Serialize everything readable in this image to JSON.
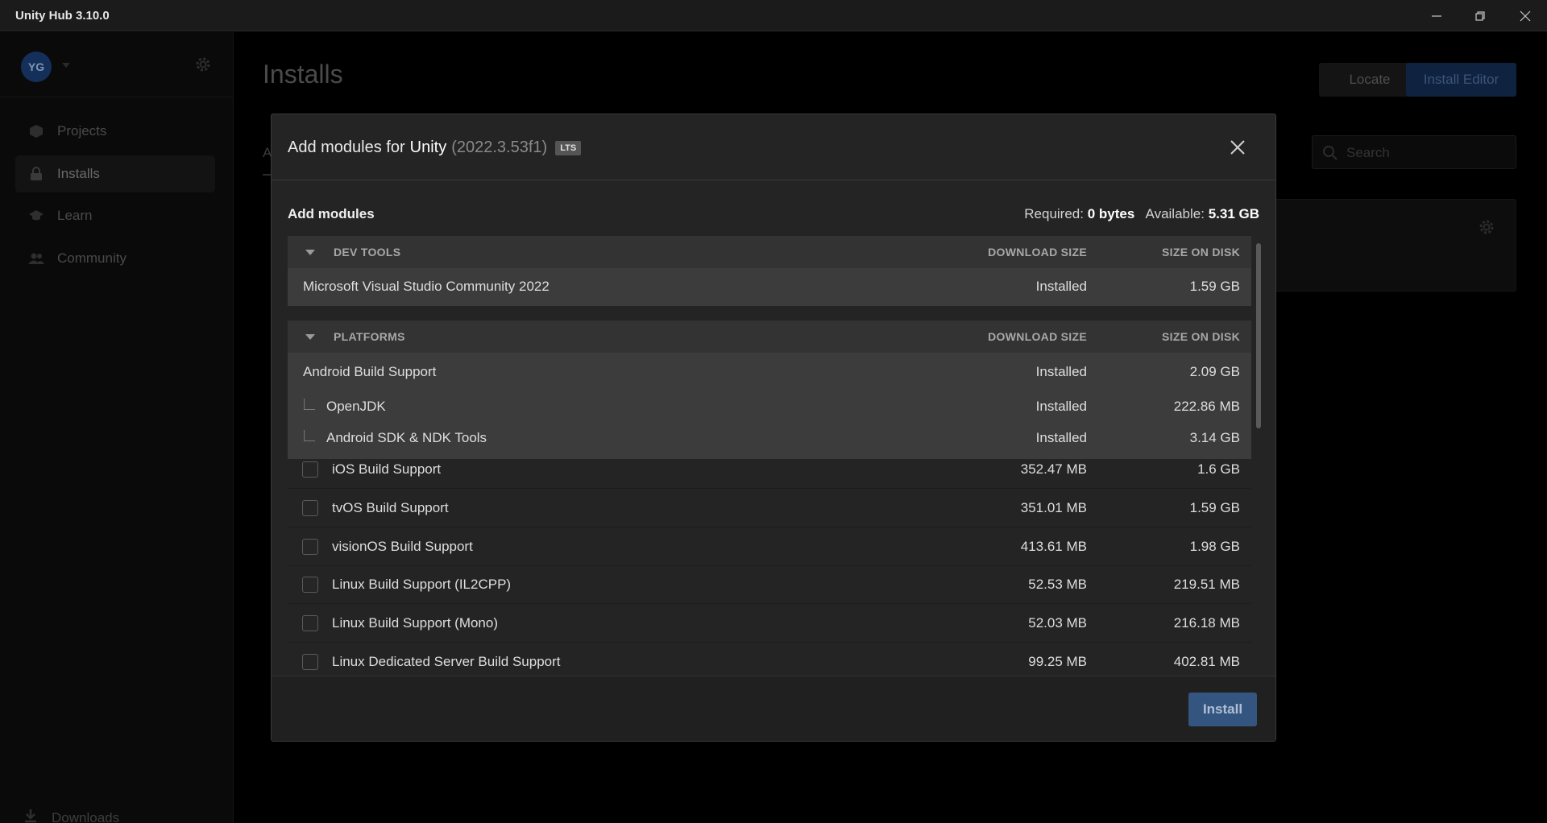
{
  "window": {
    "title": "Unity Hub 3.10.0"
  },
  "sidebar": {
    "avatar_initials": "YG",
    "items": [
      {
        "label": "Projects",
        "icon": "cube-icon"
      },
      {
        "label": "Installs",
        "icon": "lock-icon"
      },
      {
        "label": "Learn",
        "icon": "graduation-cap-icon"
      },
      {
        "label": "Community",
        "icon": "people-icon"
      }
    ],
    "downloads_label": "Downloads"
  },
  "main": {
    "title": "Installs",
    "locate_label": "Locate",
    "install_editor_label": "Install Editor",
    "tab_fragment": "A",
    "search_placeholder": "Search"
  },
  "modal": {
    "title_prefix": "Add modules for",
    "title_product": "Unity",
    "title_version": "(2022.3.53f1)",
    "badge": "LTS",
    "subheading": "Add modules",
    "required_label": "Required:",
    "required_value": "0 bytes",
    "available_label": "Available:",
    "available_value": "5.31 GB",
    "col_download": "DOWNLOAD SIZE",
    "col_disk": "SIZE ON DISK",
    "sections": {
      "dev_tools": {
        "name": "DEV TOOLS",
        "rows": [
          {
            "name": "Microsoft Visual Studio Community 2022",
            "download": "Installed",
            "disk": "1.59 GB"
          }
        ]
      },
      "platforms": {
        "name": "PLATFORMS",
        "installed_rows": [
          {
            "name": "Android Build Support",
            "download": "Installed",
            "disk": "2.09 GB"
          },
          {
            "name": "OpenJDK",
            "download": "Installed",
            "disk": "222.86 MB"
          },
          {
            "name": "Android SDK & NDK Tools",
            "download": "Installed",
            "disk": "3.14 GB"
          }
        ],
        "rows": [
          {
            "name": "iOS Build Support",
            "download": "352.47 MB",
            "disk": "1.6 GB"
          },
          {
            "name": "tvOS Build Support",
            "download": "351.01 MB",
            "disk": "1.59 GB"
          },
          {
            "name": "visionOS Build Support",
            "download": "413.61 MB",
            "disk": "1.98 GB"
          },
          {
            "name": "Linux Build Support (IL2CPP)",
            "download": "52.53 MB",
            "disk": "219.51 MB"
          },
          {
            "name": "Linux Build Support (Mono)",
            "download": "52.03 MB",
            "disk": "216.18 MB"
          },
          {
            "name": "Linux Dedicated Server Build Support",
            "download": "99.25 MB",
            "disk": "402.81 MB"
          }
        ]
      }
    },
    "install_label": "Install"
  }
}
